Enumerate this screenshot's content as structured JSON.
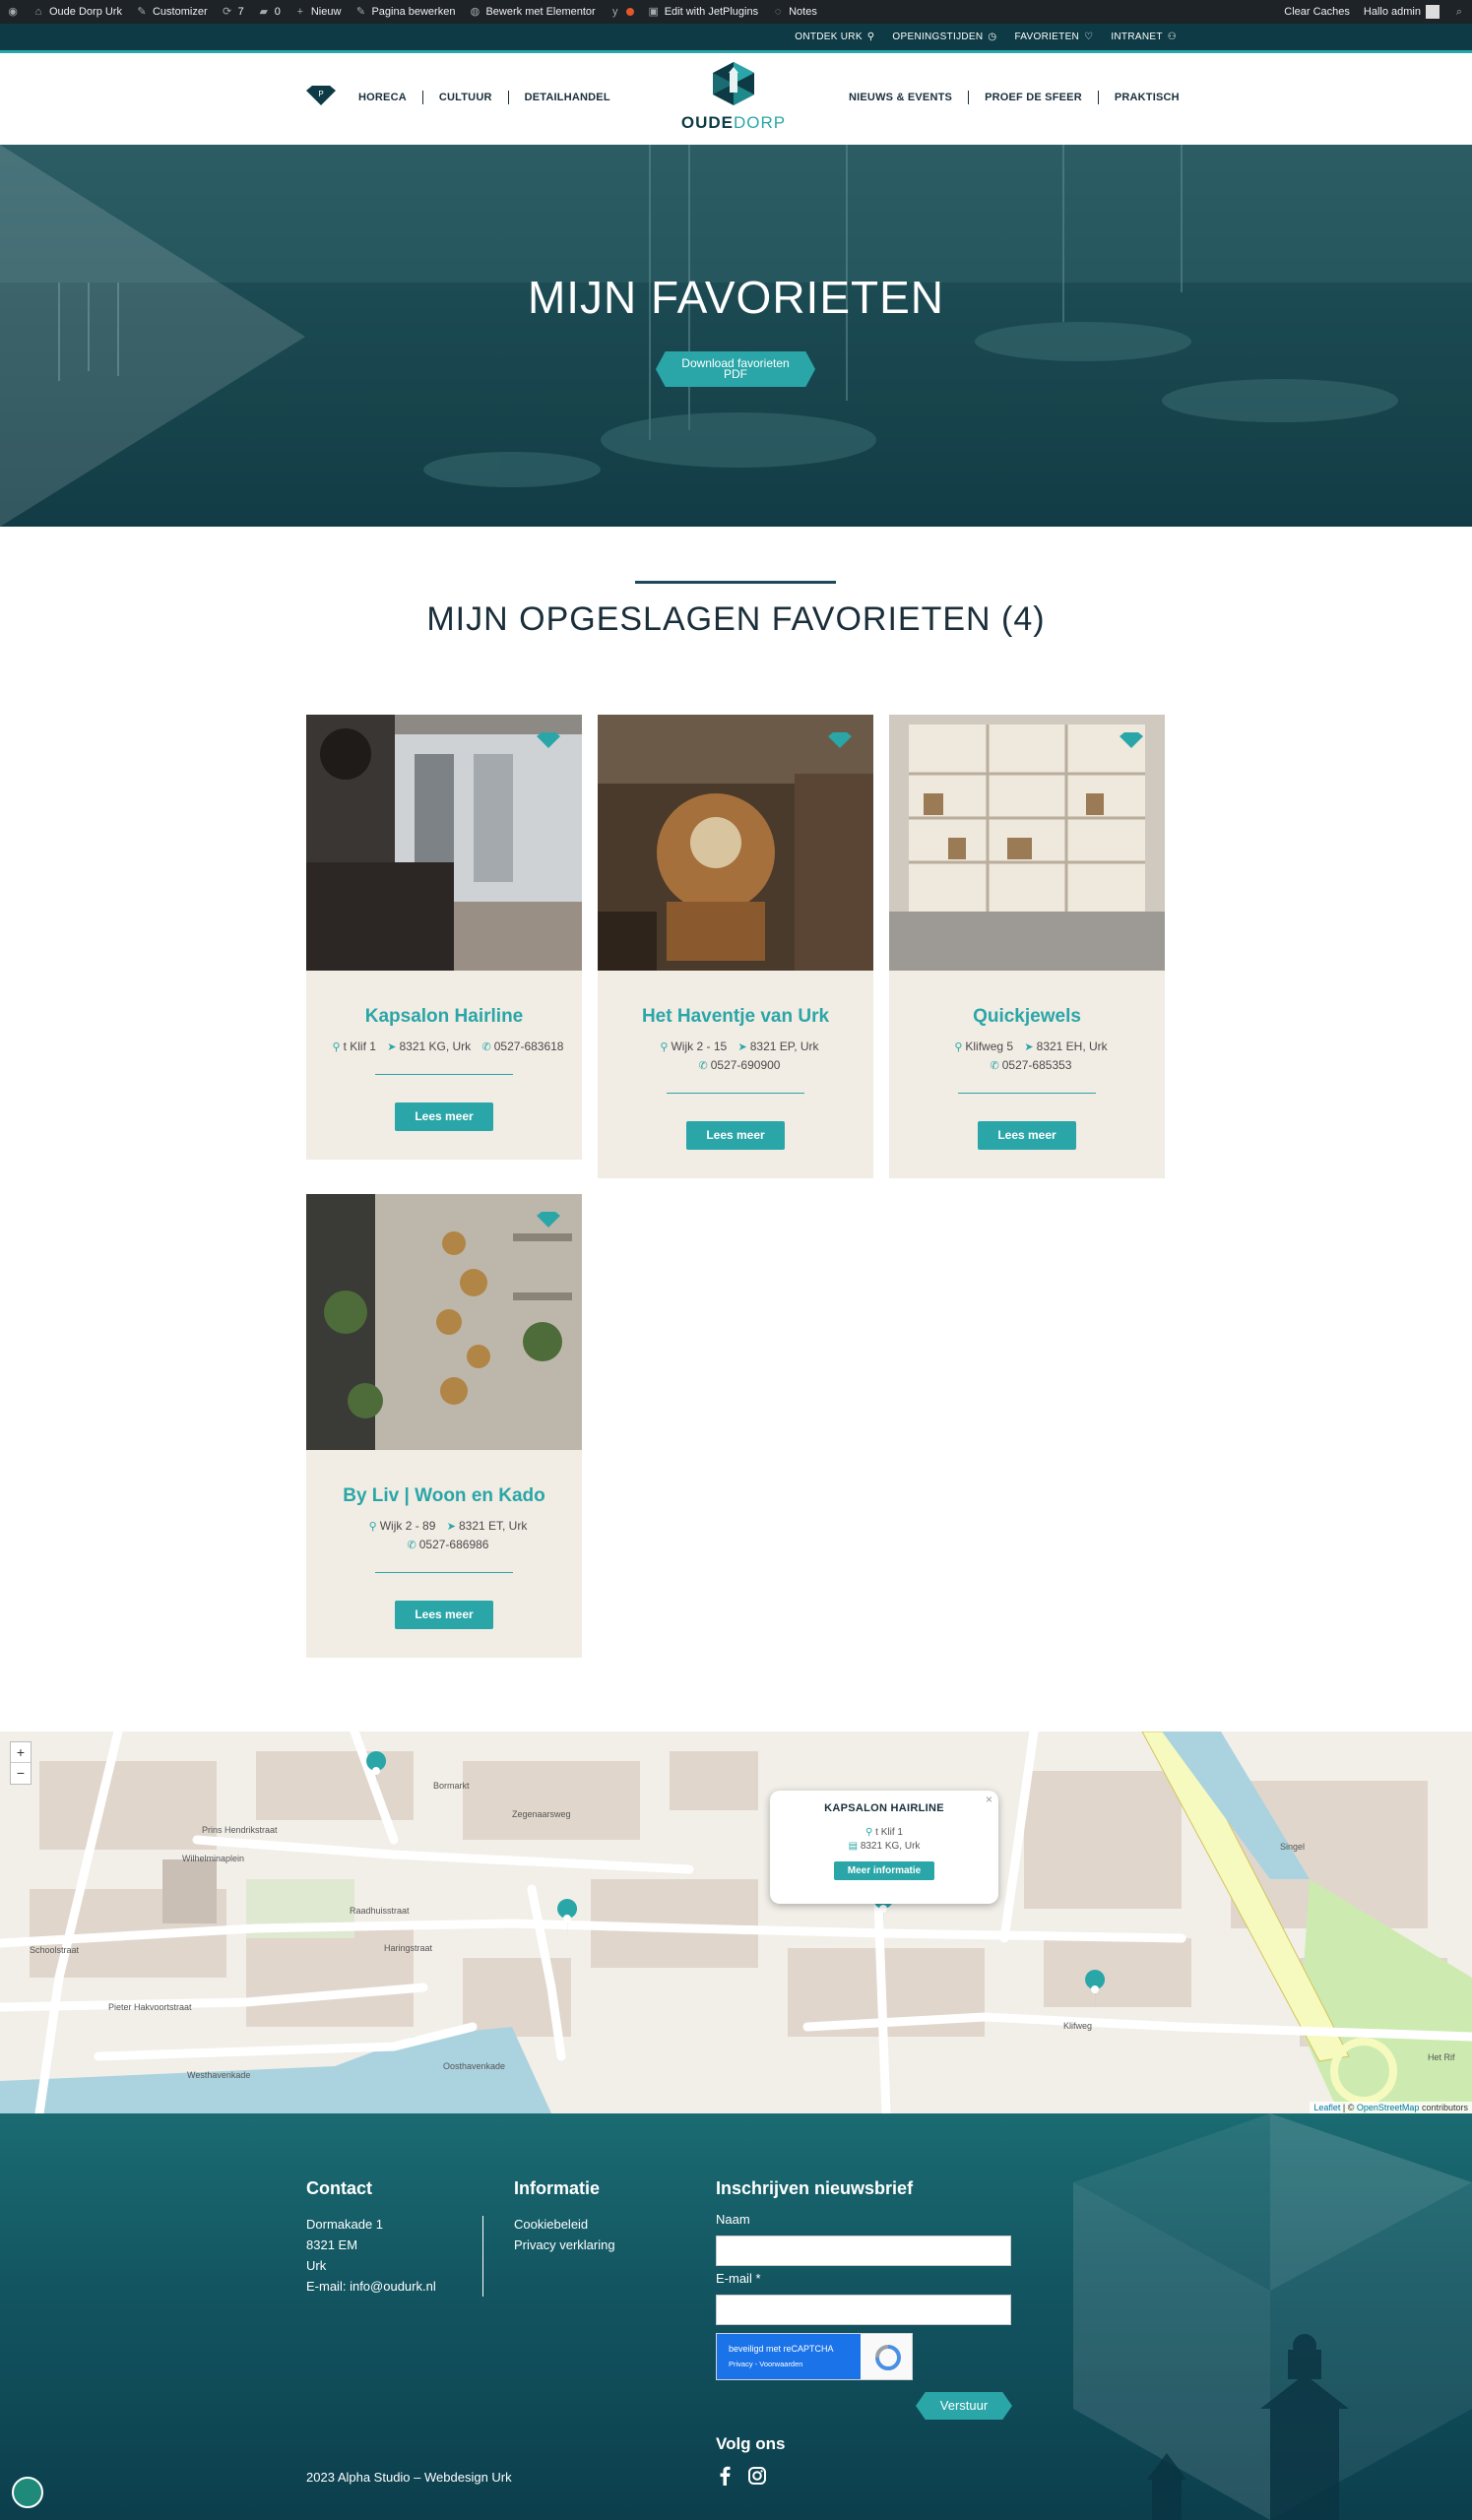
{
  "adminbar": {
    "site": "Oude Dorp Urk",
    "customizer": "Customizer",
    "updates": "7",
    "comments": "0",
    "new": "Nieuw",
    "edit_page": "Pagina bewerken",
    "elementor": "Bewerk met Elementor",
    "jet": "Edit with JetPlugins",
    "notes": "Notes",
    "clear_caches": "Clear Caches",
    "greeting": "Hallo admin"
  },
  "utilbar": {
    "items": [
      "ONTDEK URK",
      "OPENINGSTIJDEN",
      "FAVORIETEN",
      "INTRANET"
    ]
  },
  "nav": {
    "left": [
      "HORECA",
      "CULTUUR",
      "DETAILHANDEL"
    ],
    "right": [
      "NIEUWS & EVENTS",
      "PROEF DE SFEER",
      "PRAKTISCH"
    ],
    "logo_main": "OUDE",
    "logo_accent": "DORP"
  },
  "hero": {
    "title": "MIJN FAVORIETEN",
    "button_line1": "Download favorieten",
    "button_line2": "PDF"
  },
  "section": {
    "title": "MIJN OPGESLAGEN FAVORIETEN (4)"
  },
  "cards": [
    {
      "title": "Kapsalon Hairline",
      "address": "t Klif 1",
      "postal": "8321 KG, Urk",
      "phone": "0527-683618",
      "button": "Lees meer"
    },
    {
      "title": "Het Haventje van Urk",
      "address": "Wijk 2 - 15",
      "postal": "8321 EP, Urk",
      "phone": "0527-690900",
      "button": "Lees meer"
    },
    {
      "title": "Quickjewels",
      "address": "Klifweg 5",
      "postal": "8321 EH, Urk",
      "phone": "0527-685353",
      "button": "Lees meer"
    },
    {
      "title": "By Liv | Woon en Kado",
      "address": "Wijk 2 - 89",
      "postal": "8321 ET, Urk",
      "phone": "0527-686986",
      "button": "Lees meer"
    }
  ],
  "map": {
    "zoom_in": "+",
    "zoom_out": "−",
    "popup_title": "KAPSALON HAIRLINE",
    "popup_address": "t Klif 1",
    "popup_postal": "8321 KG, Urk",
    "popup_button": "Meer informatie",
    "popup_close": "×",
    "attribution_leaflet": "Leaflet",
    "attribution_osm": "OpenStreetMap",
    "attribution_rest": "contributors",
    "streets": [
      "Prins Hendrikstraat",
      "Raadhuisstraat",
      "Schoolstraat",
      "Pieter Hakvoortstraat",
      "Westhavenkade",
      "Oosthavenkade",
      "Klifweg",
      "Zegenaarsweg",
      "Bormarkt",
      "Haringstraat",
      "Wilhelminaplein",
      "Singel",
      "Het Rif"
    ]
  },
  "footer": {
    "contact_heading": "Contact",
    "contact_lines": [
      "Dormakade 1",
      "8321 EM",
      "Urk"
    ],
    "email_label": "E-mail:",
    "email": "info@oudurk.nl",
    "info_heading": "Informatie",
    "info_links": [
      "Cookiebeleid",
      "Privacy verklaring"
    ],
    "newsletter_heading": "Inschrijven nieuwsbrief",
    "name_label": "Naam",
    "email_field_label": "E-mail *",
    "recaptcha_line1": "beveiligd met reCAPTCHA",
    "recaptcha_line2": "Privacy - Voorwaarden",
    "submit": "Verstuur",
    "social_heading": "Volg ons",
    "copyright": "2023 Alpha Studio – Webdesign Urk"
  },
  "colors": {
    "teal": "#2aa6a8",
    "dark": "#0d3a44",
    "card_bg": "#f1ece4"
  }
}
